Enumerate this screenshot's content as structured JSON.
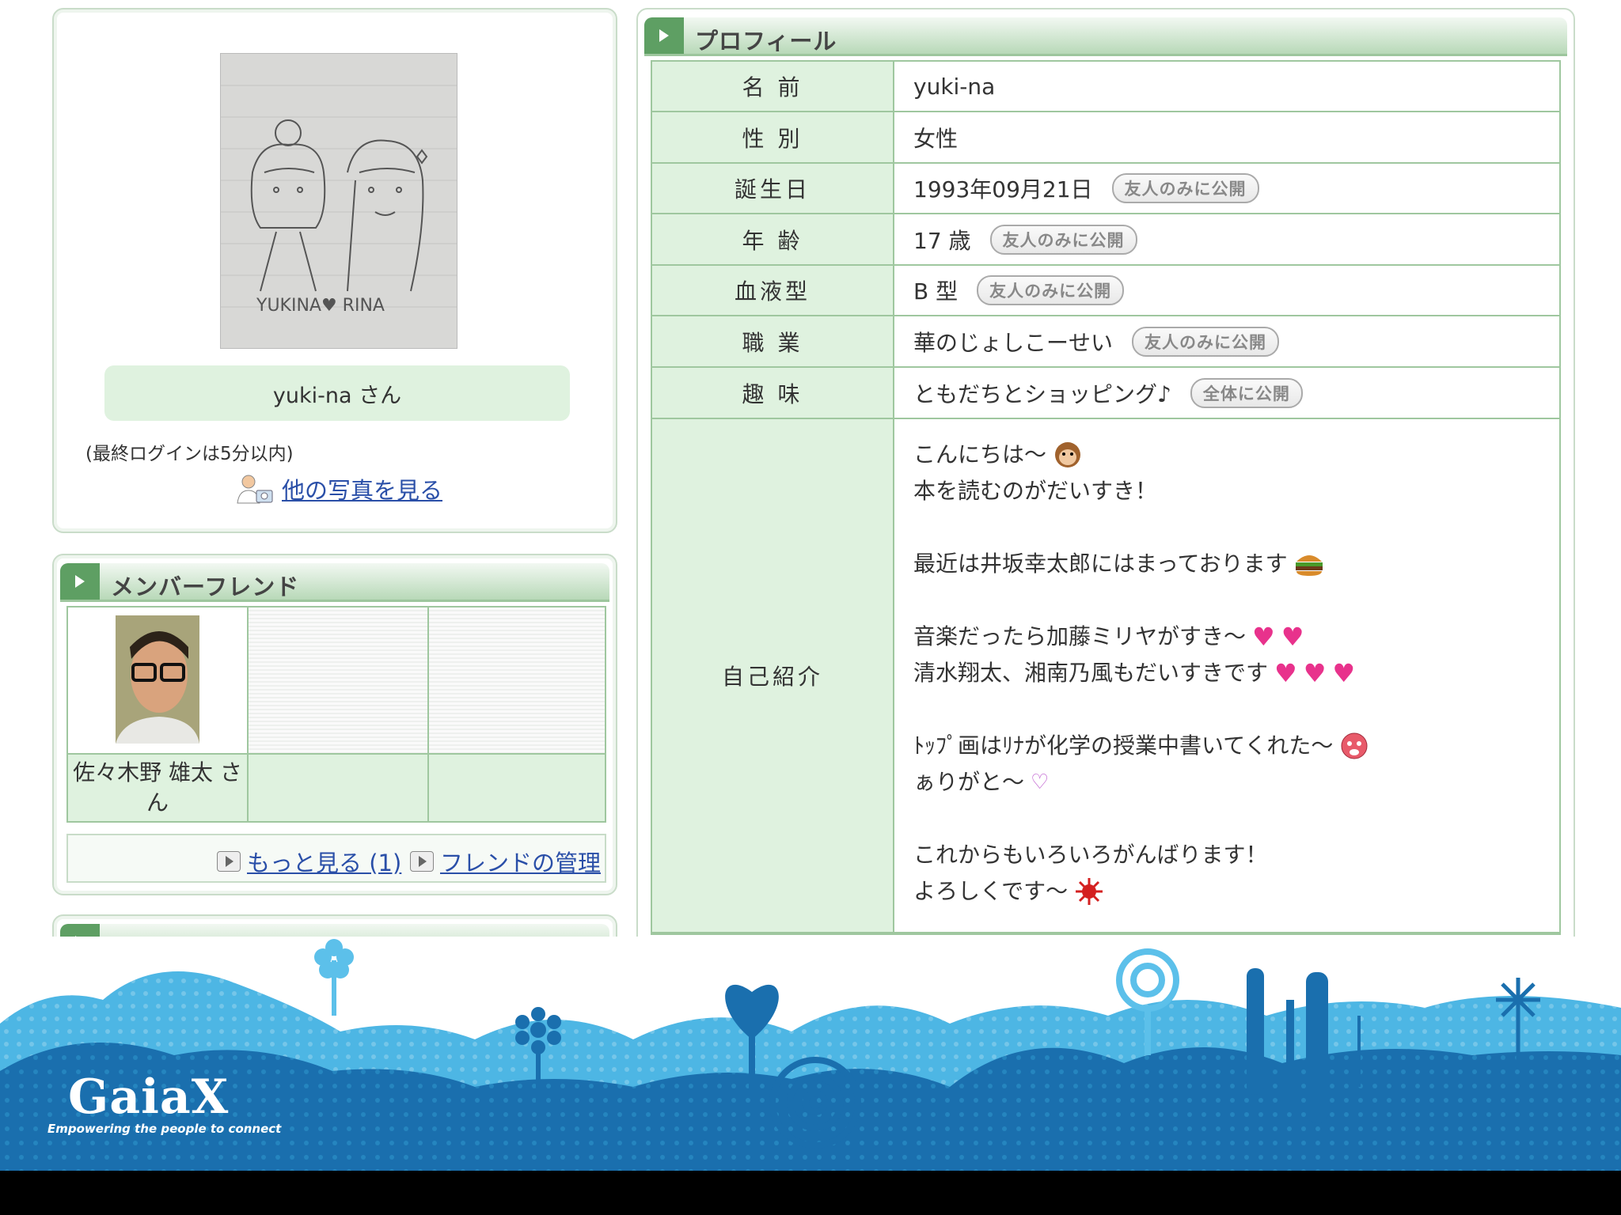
{
  "photo_panel": {
    "photo_caption": "YUKINA♥ RINA",
    "display_name": "yuki-na  さん",
    "last_login": "(最終ログインは5分以内)",
    "more_photos_label": "他の写真を見る"
  },
  "friends": {
    "title": "メンバーフレンド",
    "friend1_name": "佐々木野 雄太 さん",
    "more_link": "もっと見る (1)",
    "manage_link": "フレンドの管理"
  },
  "profile": {
    "title": "プロフィール",
    "rows": [
      {
        "label": "名 前",
        "value": "yuki-na",
        "badge": ""
      },
      {
        "label": "性 別",
        "value": "女性",
        "badge": ""
      },
      {
        "label": "誕生日",
        "value": "1993年09月21日",
        "badge": "友人のみに公開"
      },
      {
        "label": "年 齢",
        "value": "17 歳",
        "badge": "友人のみに公開"
      },
      {
        "label": "血液型",
        "value": "B 型",
        "badge": "友人のみに公開"
      },
      {
        "label": "職 業",
        "value": "華のじょしこーせい",
        "badge": "友人のみに公開"
      },
      {
        "label": "趣 味",
        "value": "ともだちとショッピング♪",
        "badge": "全体に公開"
      }
    ],
    "intro_label": "自己紹介",
    "intro_lines": [
      "こんにちは～",
      "本を読むのがだいすき！",
      "",
      "最近は井坂幸太郎にはまっております",
      "",
      "音楽だったら加藤ミリヤがすき～",
      "清水翔太、湘南乃風もだいすきです",
      "",
      "ﾄｯﾌﾟ画はﾘﾅが化学の授業中書いてくれた～",
      "ぁりがと～",
      "",
      "これからもいろいろがんばります！",
      "よろしくです～"
    ]
  },
  "brand": {
    "logo": "GaiaX",
    "tagline": "Empowering the people to connect"
  }
}
